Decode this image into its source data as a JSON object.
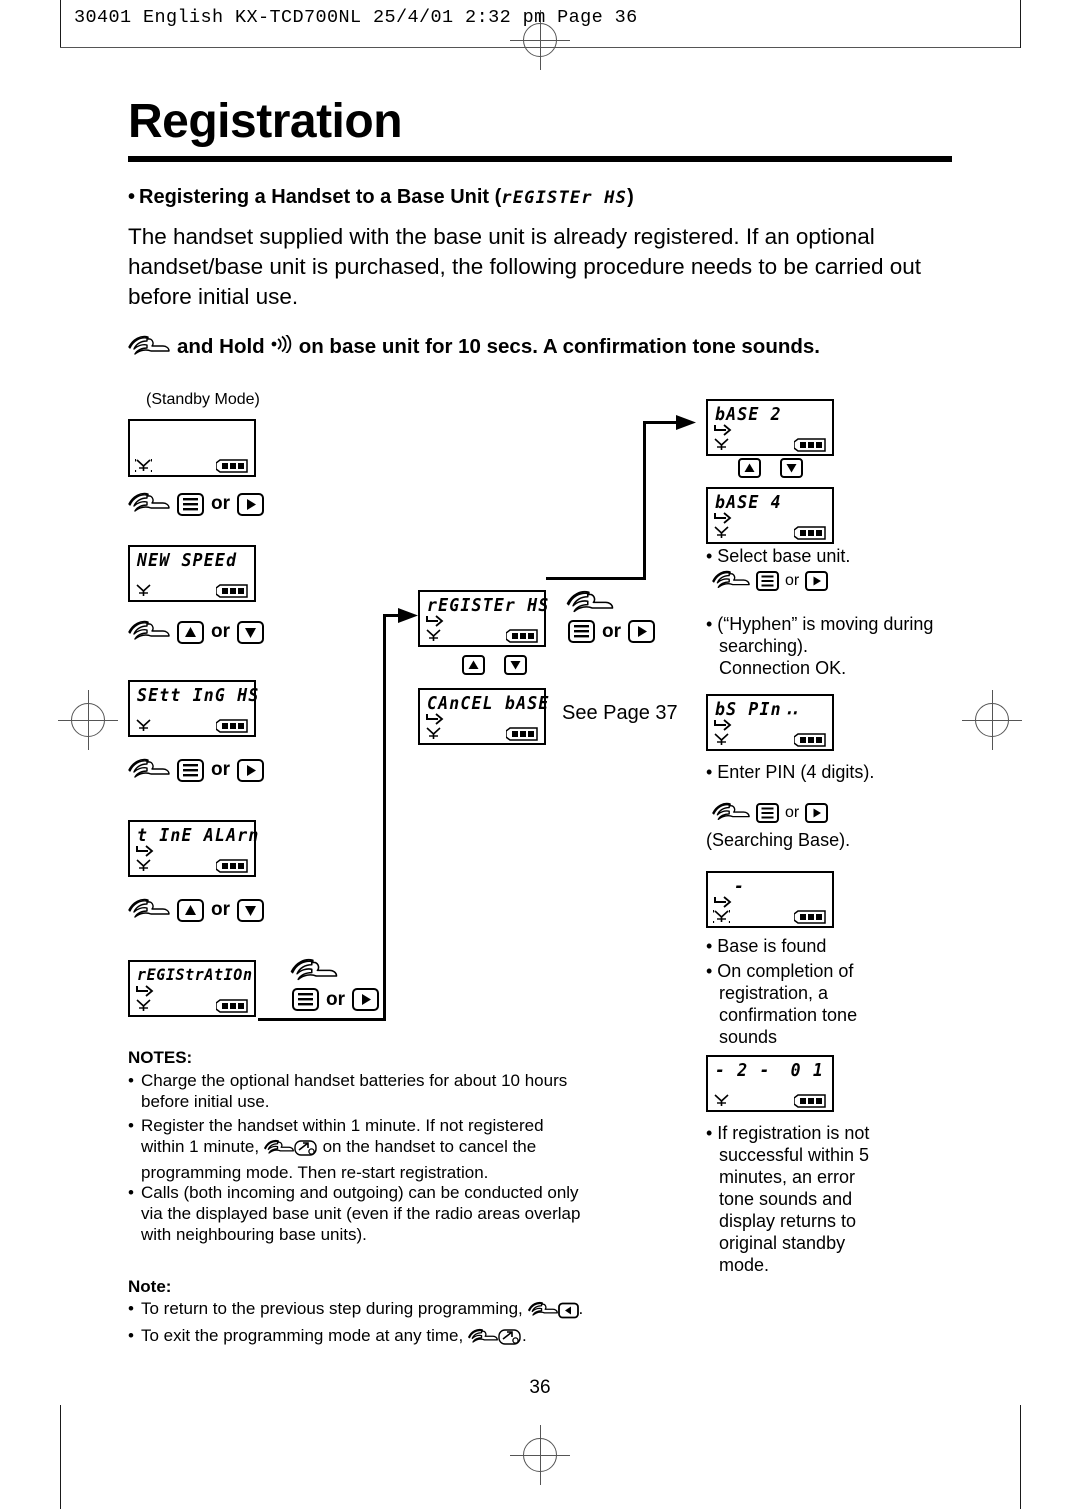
{
  "print_slug": "30401 English KX-TCD700NL  25/4/01  2:32 pm  Page 36",
  "page_number": "36",
  "title": "Registration",
  "sub_heading": {
    "bullet": "•",
    "text": "Registering a Handset to a Base Unit (",
    "lcd_term": "rEGISTEr HS",
    "close": ")"
  },
  "intro_paragraph": "The handset supplied with the base unit is already registered. If an optional handset/base unit is purchased, the following procedure needs to be carried out before initial use.",
  "hold_instruction": {
    "pre": "and Hold",
    "post": "on base unit for 10 secs. A confirmation tone sounds."
  },
  "flow": {
    "standby_label": "(Standby Mode)",
    "see_page": "See Page 37",
    "or_label": "or",
    "lcd_screens": {
      "standby": {
        "line1": "",
        "has_indicator": false
      },
      "new_speed": {
        "line1": "NEW SPEEd",
        "has_indicator": false
      },
      "setting_hs": {
        "line1": "SEtt InG HS",
        "has_indicator": false
      },
      "time_alarm": {
        "line1": "t InE ALArn",
        "has_indicator": true
      },
      "registration": {
        "line1": "rEGIStrAtIOn",
        "has_indicator": true
      },
      "register_hs": {
        "line1": "rEGISTEr HS",
        "has_indicator": true
      },
      "cancel_base": {
        "line1": "CAnCEL bASE",
        "has_indicator": true
      },
      "base_2": {
        "line1": "bASE 2",
        "has_indicator": true
      },
      "base_4": {
        "line1": "bASE 4",
        "has_indicator": true
      },
      "bs_pin": {
        "line1": "bS PIn",
        "cursor": "‥",
        "has_indicator": true
      },
      "searching": {
        "line1": "-",
        "has_indicator": true
      },
      "found": {
        "line1": "- 2 -",
        "line1_right": "0 1",
        "has_indicator": false
      }
    }
  },
  "right_column": {
    "select_base": "• Select base unit.",
    "hyphen_note_line1": "• (“Hyphen” is moving during",
    "hyphen_note_line2": "searching).",
    "hyphen_note_line3": "Connection OK.",
    "enter_pin": "• Enter PIN (4 digits).",
    "searching_base": "(Searching Base).",
    "base_found": "• Base is found",
    "completion_lines": [
      "• On completion of",
      "registration, a",
      "confirmation tone",
      "sounds"
    ],
    "failure_lines": [
      "• If registration is not",
      "successful within 5",
      "minutes, an error",
      "tone sounds and",
      "display returns to",
      "original standby",
      "mode."
    ]
  },
  "notes": {
    "heading": "NOTES:",
    "items": [
      {
        "lines": [
          "Charge the optional handset batteries for about 10 hours",
          "before initial use."
        ]
      },
      {
        "lines_pre": "Register the handset within 1 minute. If not registered",
        "mid_pre": "within 1 minute,",
        "mid_post": "on the handset to cancel the",
        "lines_post": "programming mode. Then re-start registration."
      },
      {
        "lines": [
          "Calls (both incoming and outgoing) can be conducted only",
          "via the displayed base unit (even if the radio areas overlap",
          "with neighbouring base units)."
        ]
      }
    ]
  },
  "note_single": {
    "heading": "Note:",
    "item1_pre": "To return to the previous step during programming,",
    "item1_post": ".",
    "item2_pre": "To exit the programming mode at any time,",
    "item2_post": "."
  },
  "icons": {
    "hand": "pointing-hand-icon",
    "menu_key": "menu-key-icon",
    "right_key": "right-arrow-key-icon",
    "left_key": "left-arrow-key-icon",
    "up_key": "up-arrow-key-icon",
    "down_key": "down-arrow-key-icon",
    "power_key": "power-off-key-icon",
    "speaker": "speaker-wave-icon",
    "antenna": "antenna-icon",
    "battery": "battery-icon",
    "indicator": "menu-indicator-arrow-icon"
  }
}
